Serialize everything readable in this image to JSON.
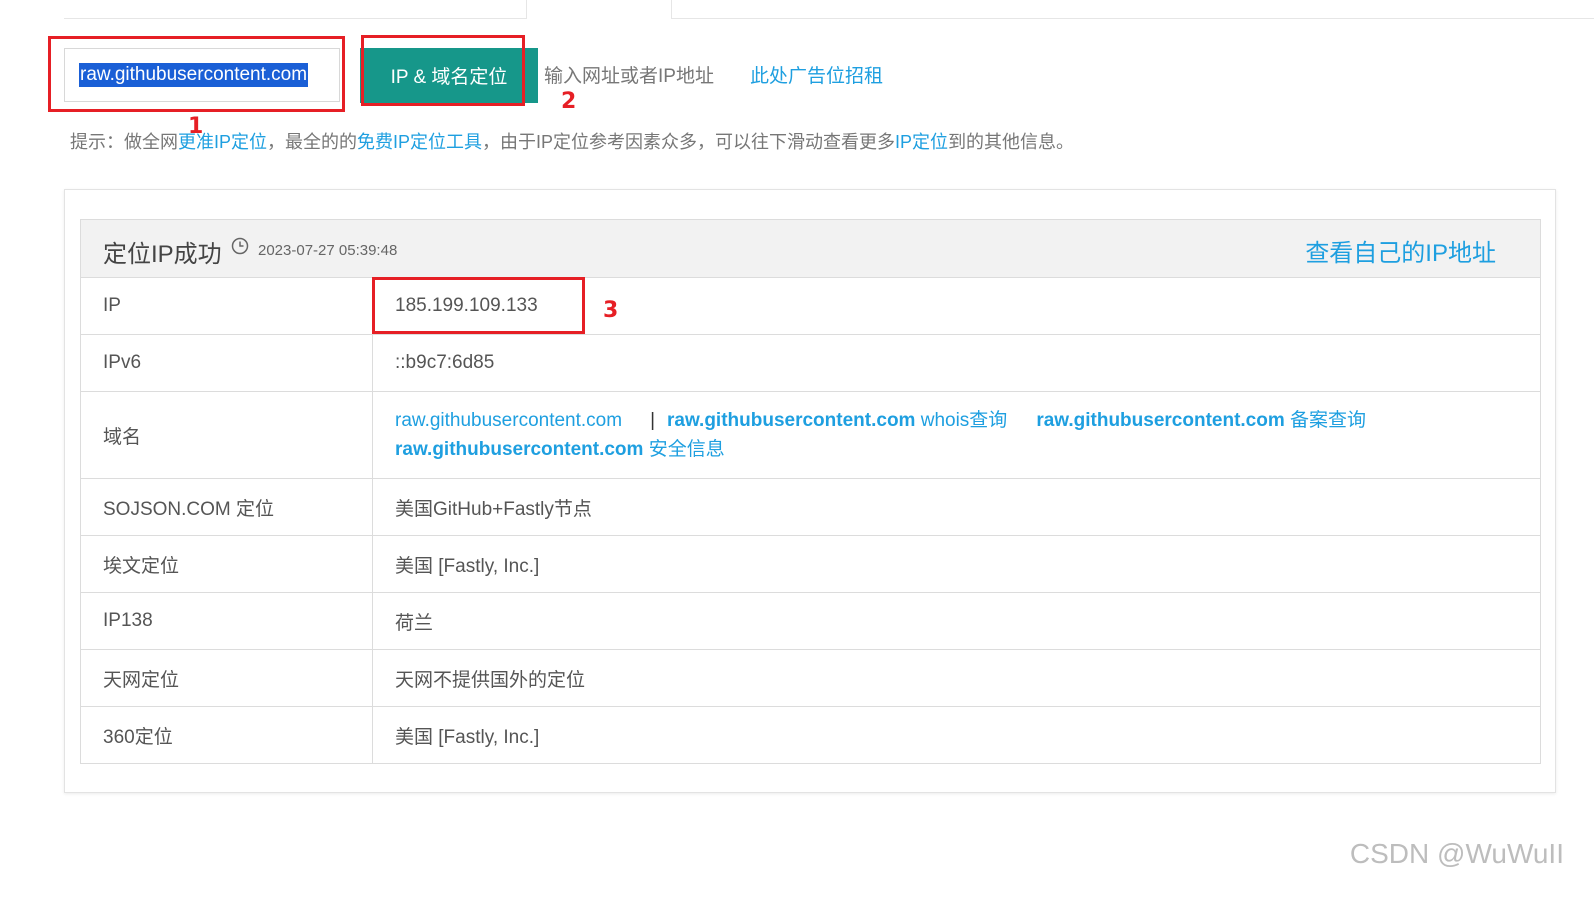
{
  "search": {
    "value": "raw.githubusercontent.com"
  },
  "locate_button": "IP & 域名定位",
  "input_hint": "输入网址或者IP地址",
  "ad_link": "此处广告位招租",
  "tip": {
    "prefix": "提示：做全网",
    "link1": "更准IP定位",
    "mid1": "，最全的的",
    "link2": "免费IP定位工具",
    "mid2": "，由于IP定位参考因素众多，可以往下滑动查看更多",
    "link3": "IP定位",
    "suffix": "到的其他信息。"
  },
  "result": {
    "title": "定位IP成功",
    "time_icon": "clock-icon",
    "timestamp": "2023-07-27 05:39:48",
    "my_ip_link": "查看自己的IP地址",
    "rows": [
      {
        "key": "IP",
        "value": "185.199.109.133"
      },
      {
        "key": "IPv6",
        "value": "::b9c7:6d85"
      },
      {
        "key": "域名",
        "domain": {
          "plain": "raw.githubusercontent.com",
          "separator": "|",
          "whois_domain": "raw.githubusercontent.com",
          "whois_label": " whois查询",
          "beian_domain": "raw.githubusercontent.com",
          "beian_label": " 备案查询",
          "security_domain": "raw.githubusercontent.com",
          "security_label": " 安全信息"
        }
      },
      {
        "key": "SOJSON.COM 定位",
        "value": "美国GitHub+Fastly节点"
      },
      {
        "key": "埃文定位",
        "value": "美国 [Fastly, Inc.]"
      },
      {
        "key": "IP138",
        "value": "荷兰"
      },
      {
        "key": "天网定位",
        "value": "天网不提供国外的定位"
      },
      {
        "key": "360定位",
        "value": "美国 [Fastly, Inc.]"
      }
    ]
  },
  "annotations": [
    "1",
    "2",
    "3"
  ],
  "colors": {
    "accent": "#16978a",
    "link": "#1e9fe0",
    "annotation": "#e61f25"
  },
  "watermark": "CSDN @WuWuII"
}
